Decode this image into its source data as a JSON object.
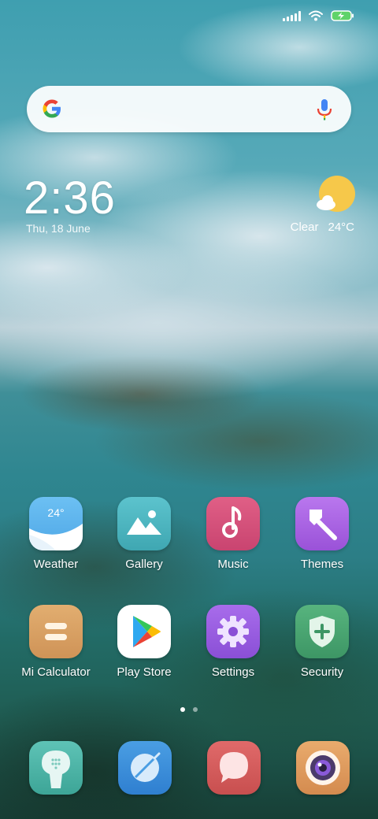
{
  "status_bar": {
    "icons": [
      "signal-icon",
      "wifi-icon",
      "battery-charging-icon"
    ]
  },
  "search_bar": {
    "logo": "google-logo",
    "mic": "mic-icon"
  },
  "clock": {
    "time": "2:36",
    "date": "Thu, 18 June"
  },
  "weather": {
    "condition": "Clear",
    "temperature": "24°C",
    "icon": "sun-cloud-icon"
  },
  "apps": [
    {
      "label": "Weather",
      "icon": "weather-app-icon",
      "badge": "24°",
      "color": "#5fb2e8"
    },
    {
      "label": "Gallery",
      "icon": "gallery-icon",
      "color": "#4fb6c0"
    },
    {
      "label": "Music",
      "icon": "music-note-icon",
      "color": "#d9537a"
    },
    {
      "label": "Themes",
      "icon": "paintbrush-icon",
      "color": "#a760e0"
    },
    {
      "label": "Mi Calculator",
      "icon": "calculator-icon",
      "color": "#d9a063"
    },
    {
      "label": "Play Store",
      "icon": "play-store-icon",
      "color": "#ffffff"
    },
    {
      "label": "Settings",
      "icon": "gear-icon",
      "color": "#9a5ee0"
    },
    {
      "label": "Security",
      "icon": "shield-plus-icon",
      "color": "#4aa371"
    }
  ],
  "page_indicator": {
    "pages": 2,
    "active": 1
  },
  "dock": [
    {
      "icon": "phone-dialer-icon",
      "color": "#4bb3a8"
    },
    {
      "icon": "browser-icon",
      "color": "#3c8fd9"
    },
    {
      "icon": "messaging-icon",
      "color": "#d85a5a"
    },
    {
      "icon": "camera-icon",
      "color": "#e09b5c"
    }
  ],
  "colors": {
    "text": "#ffffff",
    "sun": "#f6c84a"
  }
}
